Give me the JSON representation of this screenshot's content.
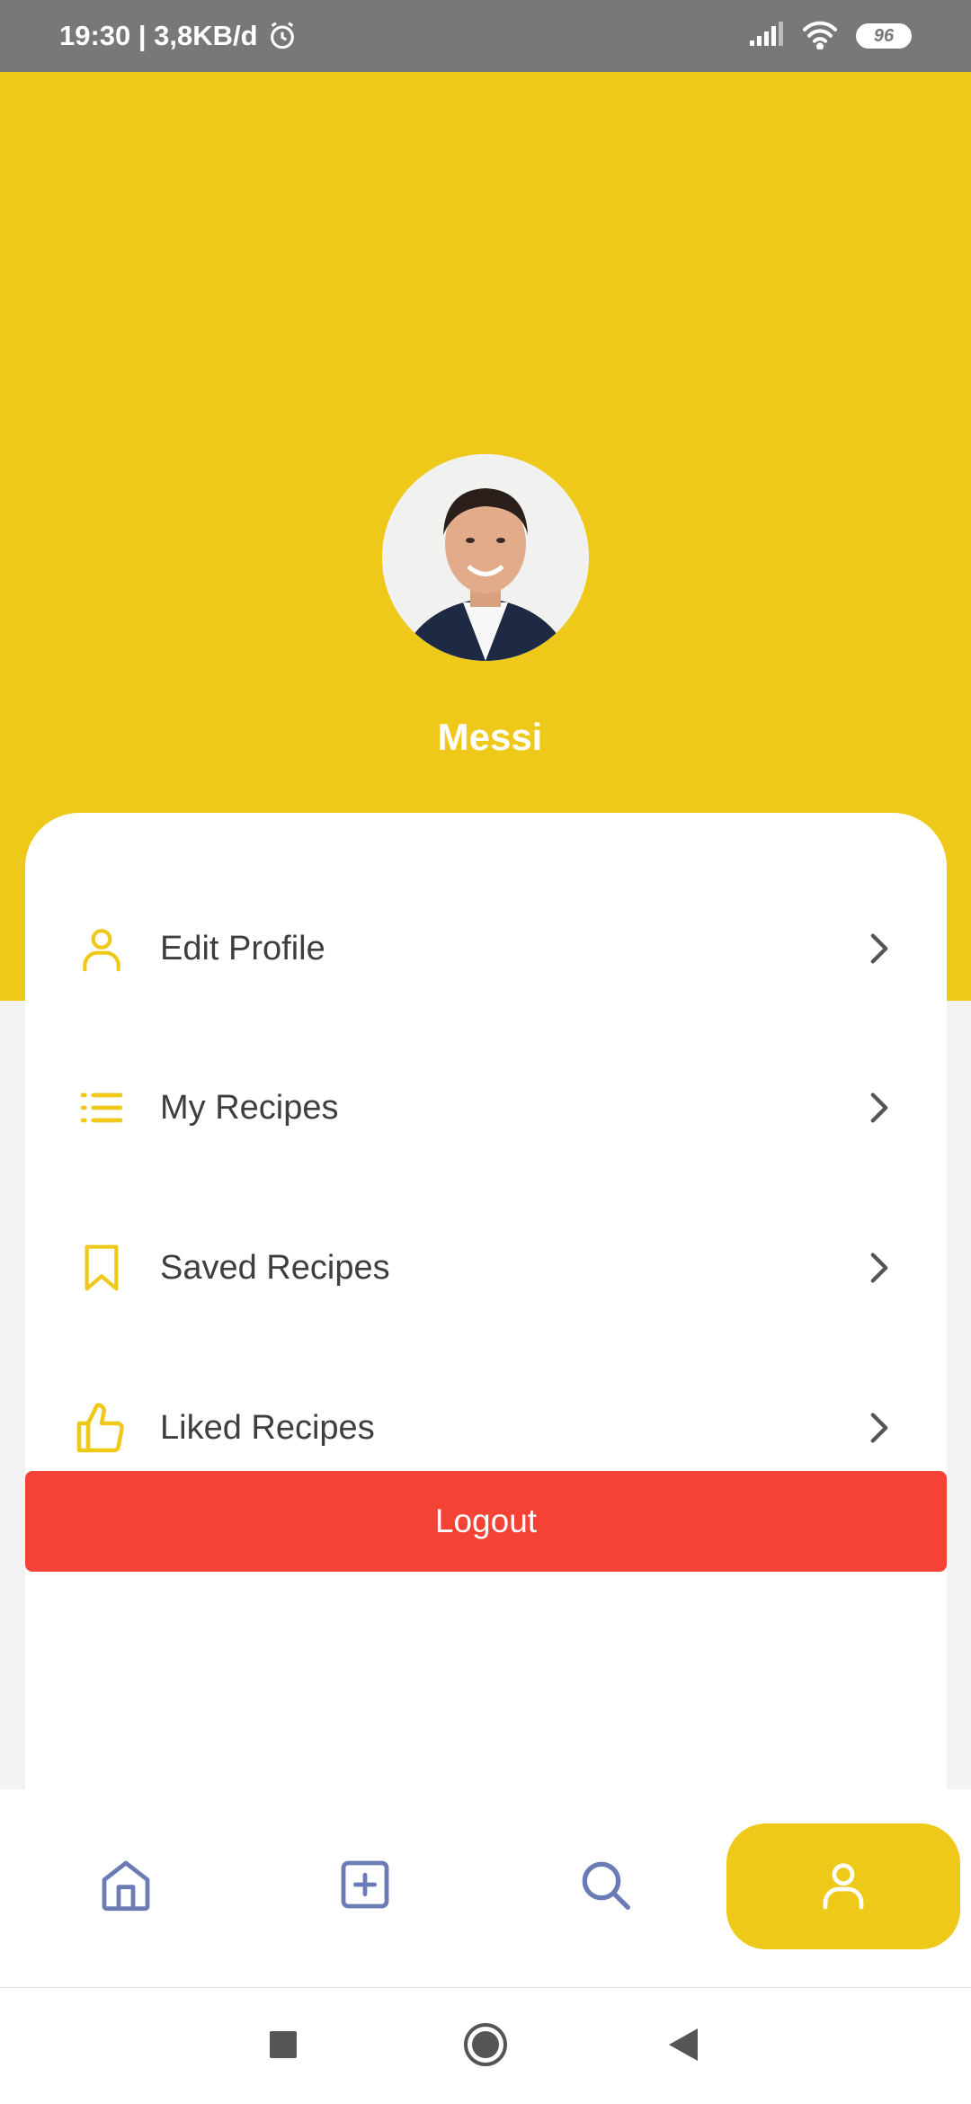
{
  "status_bar": {
    "time_net": "19:30 | 3,8KB/d",
    "battery": "96"
  },
  "profile": {
    "name": "Messi"
  },
  "menu": [
    {
      "label": "Edit Profile",
      "icon": "person-icon"
    },
    {
      "label": "My Recipes",
      "icon": "list-icon"
    },
    {
      "label": "Saved Recipes",
      "icon": "bookmark-icon"
    },
    {
      "label": "Liked Recipes",
      "icon": "thumbs-up-icon"
    }
  ],
  "logout_label": "Logout",
  "bottom_nav": [
    {
      "icon": "home-icon",
      "active": false
    },
    {
      "icon": "add-square-icon",
      "active": false
    },
    {
      "icon": "search-icon",
      "active": false
    },
    {
      "icon": "person-icon",
      "active": true
    }
  ],
  "colors": {
    "accent": "#efc919",
    "logout": "#f44336",
    "nav_icon": "#6b7bb5"
  }
}
